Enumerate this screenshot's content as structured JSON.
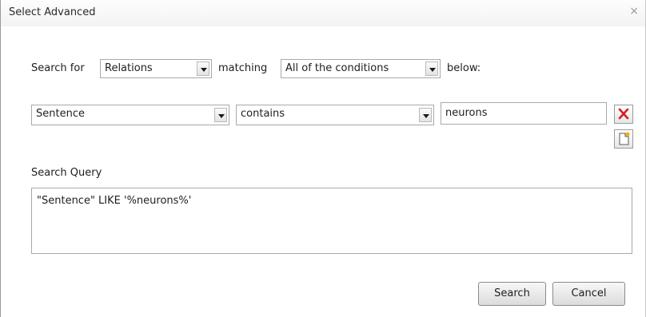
{
  "window": {
    "title": "Select Advanced",
    "close_glyph": "×"
  },
  "search_row": {
    "search_for_label": "Search for",
    "entity_select": "Relations",
    "matching_label": "matching",
    "condition_mode_select": "All of the conditions",
    "below_label": "below:"
  },
  "condition": {
    "field_select": "Sentence",
    "operator_select": "contains",
    "value": "neurons",
    "remove_icon": "red-x-delete-icon",
    "add_icon": "new-document-add-icon",
    "remove_color": "#d42020"
  },
  "query": {
    "label": "Search Query",
    "text": "\"Sentence\" LIKE '%neurons%'"
  },
  "buttons": {
    "search": "Search",
    "cancel": "Cancel"
  }
}
